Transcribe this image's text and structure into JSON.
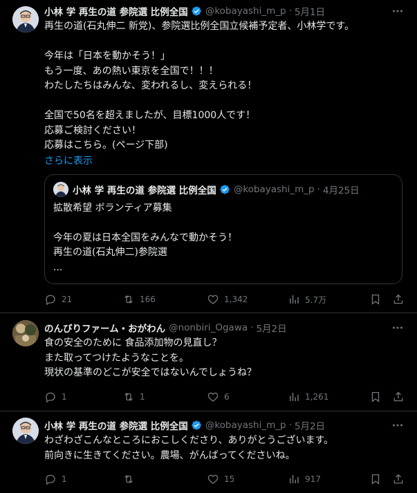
{
  "tweets": [
    {
      "name": "小林 学 再生の道 参院選 比例全国",
      "handle": "@kobayashi_m_p",
      "date": "5月1日",
      "body": "再生の道(石丸伸二 新党)、参院選比例全国立候補予定者、小林学です。\n\n今年は「日本を動かそう！」\nもう一度、あの熱い東京を全国で！！！\nわたしたちはみんな、変われるし、変えられる！\n\n全国で50名を超えましたが、目標1000人です！\n応募ご検討ください！\n応募はこちら。(ページ下部)",
      "show_more": "さらに表示",
      "quote": {
        "name": "小林 学 再生の道 参院選 比例全国",
        "handle": "@kobayashi_m_p",
        "date": "4月25日",
        "body": "拡散希望 ボランティア募集\n\n今年の夏は日本全国をみんなで動かそう！\n再生の道(石丸伸二)参院選\n..."
      },
      "stats": {
        "replies": "21",
        "retweets": "166",
        "likes": "1,342",
        "views": "5.7万"
      }
    },
    {
      "name": "のんびりファーム・おがわん",
      "handle": "@nonbiri_Ogawa",
      "date": "5月2日",
      "body": "食の安全のために 食品添加物の見直し？\nまた取ってつけたようなことを。\n現状の基準のどこが安全ではないんでしょうね？",
      "stats": {
        "replies": "1",
        "retweets": "1",
        "likes": "6",
        "views": "1,261"
      }
    },
    {
      "name": "小林 学 再生の道 参院選 比例全国",
      "handle": "@kobayashi_m_p",
      "date": "5月2日",
      "body": "わざわざこんなところにおこしくださり、ありがとうございます。\n前向きに生きてください。農場、がんばってくださいね。",
      "stats": {
        "replies": "1",
        "retweets": "",
        "likes": "15",
        "views": "917"
      }
    }
  ],
  "icons": [
    "more-icon",
    "verified-badge-icon",
    "reply-icon",
    "retweet-icon",
    "like-icon",
    "views-icon",
    "bookmark-icon",
    "share-icon"
  ],
  "colors": {
    "background": "#000000",
    "text": "#e7e9ea",
    "muted": "#71767b",
    "link": "#1d9bf0",
    "verified": "#1d9bf0",
    "border": "#2f3336"
  }
}
